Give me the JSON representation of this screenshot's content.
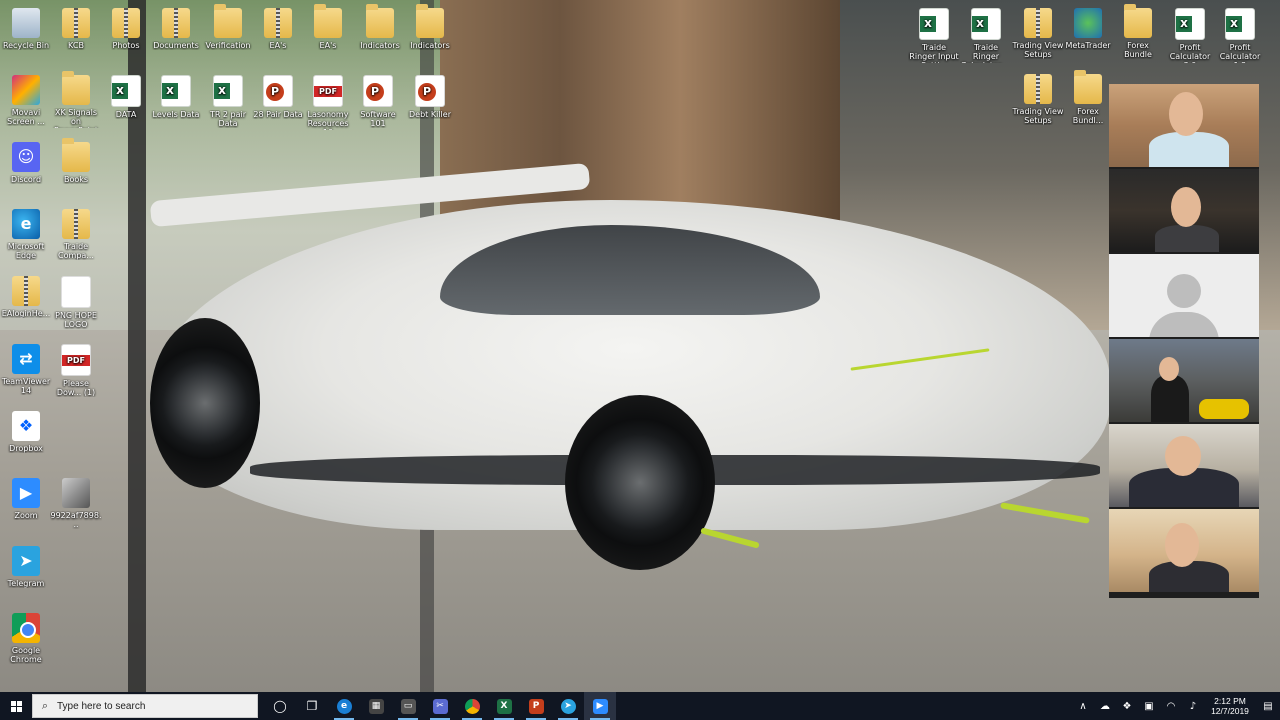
{
  "desktop": {
    "icons": [
      {
        "label": "Recycle Bin",
        "kind": "recycle"
      },
      {
        "label": "KCB",
        "kind": "zip"
      },
      {
        "label": "Photos",
        "kind": "zip"
      },
      {
        "label": "Documents",
        "kind": "zip"
      },
      {
        "label": "Verification",
        "kind": "folder"
      },
      {
        "label": "EA's",
        "kind": "zip"
      },
      {
        "label": "EA's",
        "kind": "folder"
      },
      {
        "label": "Indicators",
        "kind": "folder"
      },
      {
        "label": "Indicators",
        "kind": "folder"
      },
      {
        "label": "Movavi Screen ...",
        "kind": "movavi"
      },
      {
        "label": "XK Signals on PowerPoint",
        "kind": "folder"
      },
      {
        "label": "DATA",
        "kind": "excel"
      },
      {
        "label": "Levels Data",
        "kind": "excel"
      },
      {
        "label": "TR 2 pair Data",
        "kind": "excel"
      },
      {
        "label": "28 Pair Data",
        "kind": "ppt"
      },
      {
        "label": "Lasonomy Resources 10",
        "kind": "pdf"
      },
      {
        "label": "Software 101",
        "kind": "ppt"
      },
      {
        "label": "Debt Killer",
        "kind": "ppt"
      },
      {
        "label": "Discord",
        "kind": "discord"
      },
      {
        "label": "Books",
        "kind": "folder"
      },
      {
        "label": "Microsoft Edge",
        "kind": "edge"
      },
      {
        "label": "Traide Compa...",
        "kind": "zip"
      },
      {
        "label": "EAloginHe...",
        "kind": "zip"
      },
      {
        "label": "PNG HOPE LOGO",
        "kind": "png"
      },
      {
        "label": "TeamViewer 14",
        "kind": "teamviewer"
      },
      {
        "label": "Please Dow... (1)",
        "kind": "pdf"
      },
      {
        "label": "Dropbox",
        "kind": "dropbox"
      },
      {
        "label": "Zoom",
        "kind": "zoom"
      },
      {
        "label": "9922af7898...",
        "kind": "photo"
      },
      {
        "label": "Telegram",
        "kind": "telegram"
      },
      {
        "label": "Google Chrome",
        "kind": "chrome"
      },
      {
        "label": "Traide Ringer Input Setti...",
        "kind": "excel"
      },
      {
        "label": "Traide Ringer Calculator ...",
        "kind": "excel"
      },
      {
        "label": "Trading View Setups",
        "kind": "zip"
      },
      {
        "label": "MetaTrader",
        "kind": "meta"
      },
      {
        "label": "Forex Bundle",
        "kind": "folder"
      },
      {
        "label": "Profit Calculator 3.0",
        "kind": "excel"
      },
      {
        "label": "Profit Calculator 1.2",
        "kind": "excel"
      },
      {
        "label": "Trading View Setups",
        "kind": "zip"
      },
      {
        "label": "Forex Bundl...",
        "kind": "folder"
      }
    ]
  },
  "taskbar": {
    "search_placeholder": "Type here to search",
    "time": "2:12 PM",
    "date": "12/7/2019"
  },
  "colors": {
    "taskbar_bg": "#101622",
    "accent_green": "#b9d630"
  }
}
